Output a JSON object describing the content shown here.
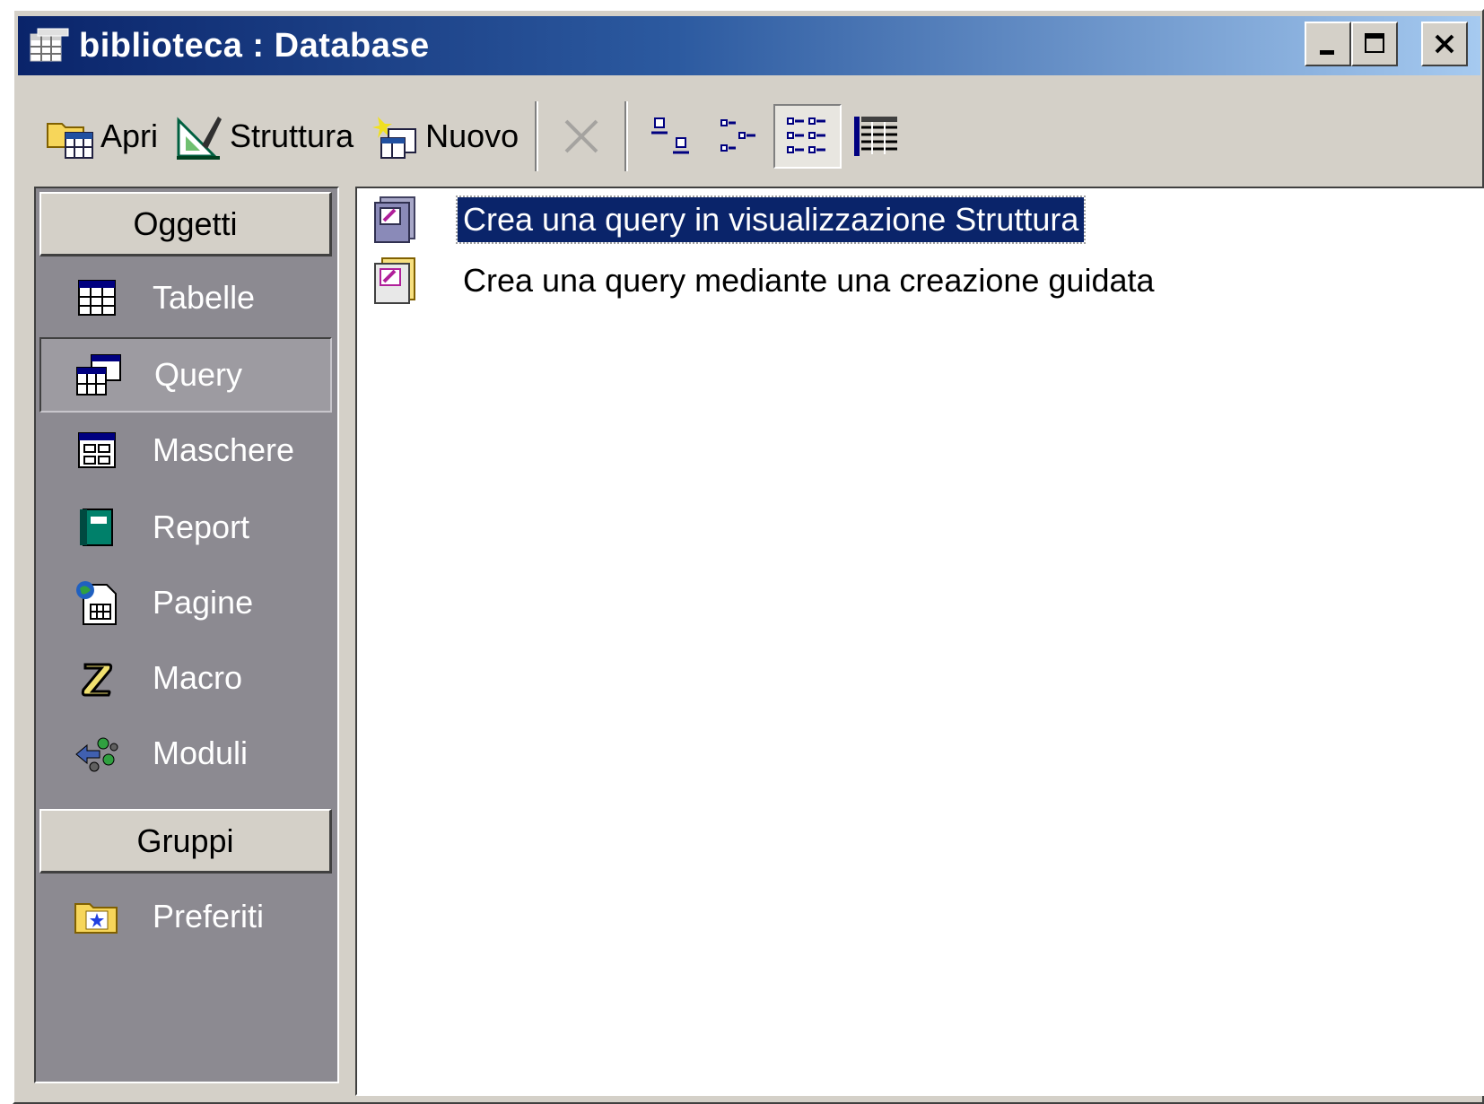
{
  "window": {
    "title": "biblioteca : Database",
    "minimize_glyph": "_",
    "close_glyph": "×"
  },
  "toolbar": {
    "open_label": "Apri",
    "design_label": "Struttura",
    "new_label": "Nuovo"
  },
  "objects_panel": {
    "objects_header": "Oggetti",
    "items": [
      {
        "label": "Tabelle",
        "icon": "table-icon"
      },
      {
        "label": "Query",
        "icon": "query-icon",
        "selected": true
      },
      {
        "label": "Maschere",
        "icon": "form-icon"
      },
      {
        "label": "Report",
        "icon": "report-icon"
      },
      {
        "label": "Pagine",
        "icon": "page-icon"
      },
      {
        "label": "Macro",
        "icon": "macro-icon"
      },
      {
        "label": "Moduli",
        "icon": "module-icon"
      }
    ],
    "groups_header": "Gruppi",
    "groups": [
      {
        "label": "Preferiti",
        "icon": "favorites-folder-icon"
      }
    ]
  },
  "list": {
    "items": [
      {
        "label": "Crea una query in visualizzazione Struttura",
        "icon": "design-query-icon",
        "selected": true
      },
      {
        "label": "Crea una query mediante una creazione guidata",
        "icon": "wizard-query-icon"
      }
    ]
  },
  "colors": {
    "title_gradient_start": "#0a246a",
    "title_gradient_end": "#a6caf0",
    "selection": "#0a246a",
    "panel_gray": "#8c8a91",
    "face": "#d4d0c8"
  }
}
